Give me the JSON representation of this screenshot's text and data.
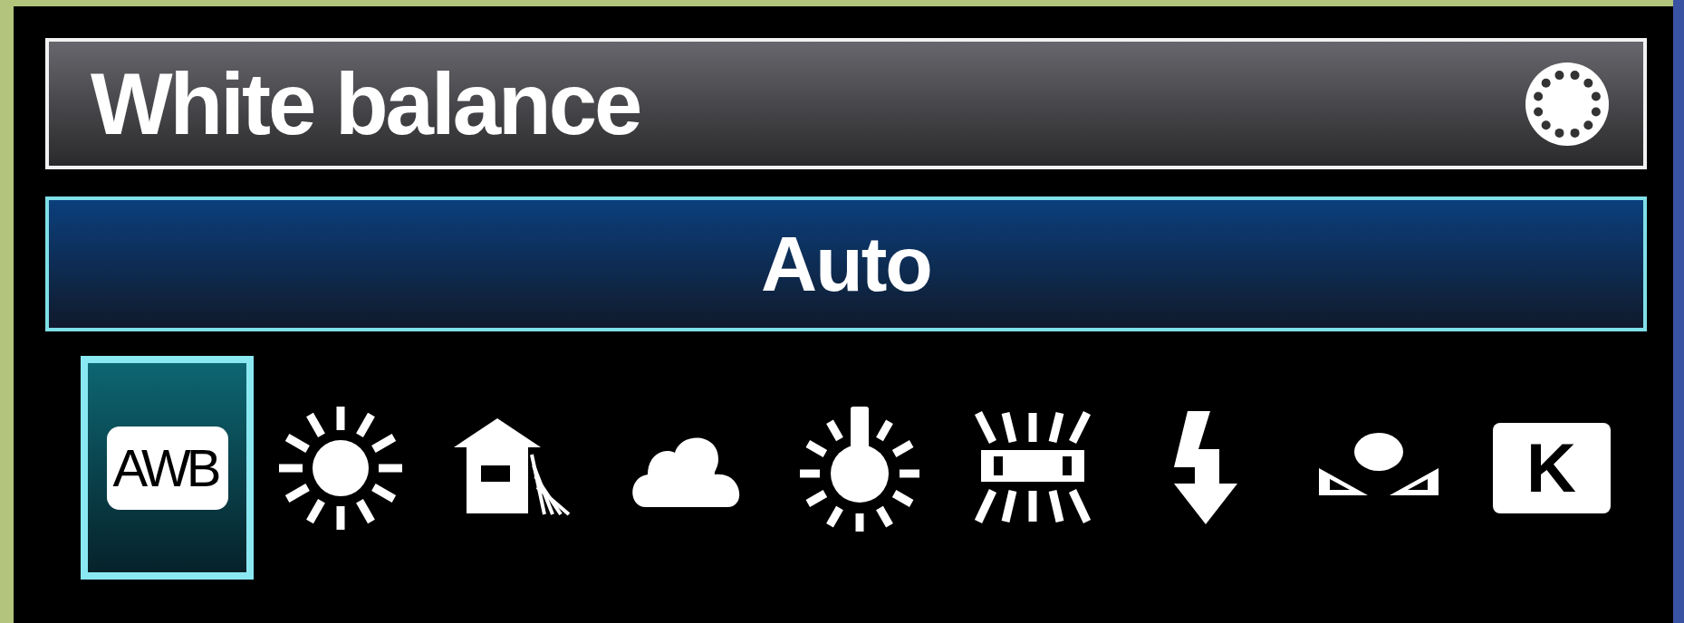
{
  "header": {
    "title": "White balance"
  },
  "current": {
    "label": "Auto"
  },
  "presets": [
    {
      "kind": "awb",
      "label": "AWB",
      "selected": true
    },
    {
      "kind": "daylight",
      "selected": false
    },
    {
      "kind": "shade",
      "selected": false
    },
    {
      "kind": "cloudy",
      "selected": false
    },
    {
      "kind": "tungsten",
      "selected": false
    },
    {
      "kind": "fluorescent",
      "selected": false
    },
    {
      "kind": "flash",
      "selected": false
    },
    {
      "kind": "custom",
      "selected": false
    },
    {
      "kind": "kelvin",
      "label": "K",
      "selected": false
    }
  ]
}
